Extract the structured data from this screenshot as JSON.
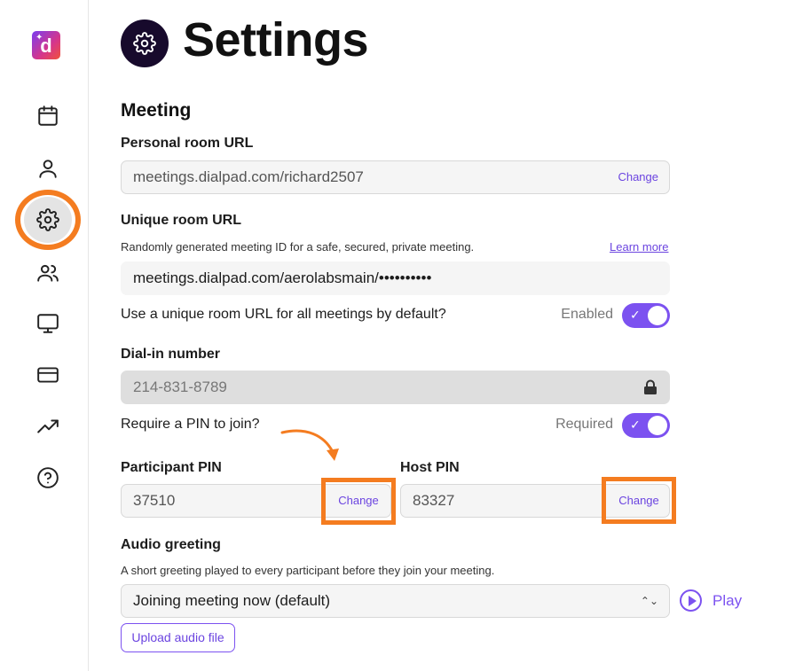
{
  "sidebar": {
    "logo_letter": "d",
    "items": [
      {
        "icon": "calendar-icon"
      },
      {
        "icon": "user-icon"
      },
      {
        "icon": "gear-icon",
        "active": true
      },
      {
        "icon": "users-icon"
      },
      {
        "icon": "monitor-icon"
      },
      {
        "icon": "credit-card-icon"
      },
      {
        "icon": "trending-up-icon"
      },
      {
        "icon": "help-icon"
      }
    ]
  },
  "header": {
    "title": "Settings",
    "icon": "gear-icon"
  },
  "meeting": {
    "section_title": "Meeting",
    "personal_room": {
      "label": "Personal room URL",
      "value": "meetings.dialpad.com/richard2507",
      "change_label": "Change"
    },
    "unique_room": {
      "label": "Unique room URL",
      "description": "Randomly generated meeting ID for a safe, secured, private meeting.",
      "learn_more": "Learn more",
      "value": "meetings.dialpad.com/aerolabsmain/••••••••••"
    },
    "unique_default": {
      "question": "Use a unique room URL for all meetings by default?",
      "status": "Enabled",
      "enabled": true
    },
    "dial_in": {
      "label": "Dial-in number",
      "value": "214-831-8789",
      "icon": "lock-icon"
    },
    "require_pin": {
      "question": "Require a PIN to join?",
      "status": "Required",
      "enabled": true
    },
    "participant_pin": {
      "label": "Participant PIN",
      "value": "37510",
      "change_label": "Change"
    },
    "host_pin": {
      "label": "Host PIN",
      "value": "83327",
      "change_label": "Change"
    },
    "audio_greeting": {
      "label": "Audio greeting",
      "description": "A short greeting played to every participant before they join your meeting.",
      "selected": "Joining meeting now (default)",
      "play_label": "Play",
      "upload_label": "Upload audio file"
    }
  },
  "colors": {
    "accent": "#7c52f0",
    "highlight": "#f47c20",
    "header_icon_bg": "#170a2c"
  }
}
